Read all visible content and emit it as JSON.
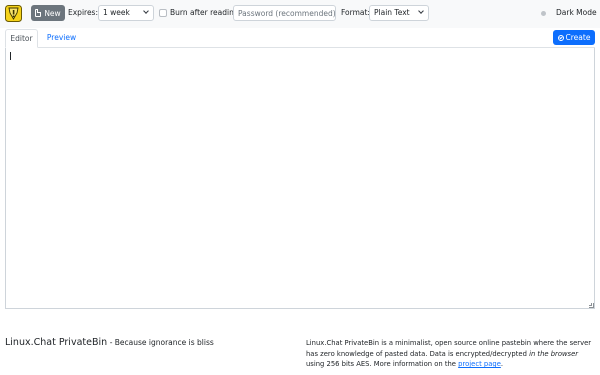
{
  "toolbar": {
    "new_label": "New",
    "expires_label": "Expires:",
    "expires_value": "1 week",
    "burn_label": "Burn after reading",
    "password_placeholder": "Password (recommended)",
    "format_label": "Format:",
    "format_value": "Plain Text",
    "dark_mode_label": "Dark Mode"
  },
  "tabs": [
    {
      "label": "Editor",
      "active": true
    },
    {
      "label": "Preview",
      "active": false
    }
  ],
  "create_label": "Create",
  "editor": {
    "value": ""
  },
  "footer": {
    "brand": "Linux.Chat PrivateBin",
    "tagline": "- Because ignorance is bliss",
    "about_part1": "Linux.Chat PrivateBin is a minimalist, open source online pastebin where the server has zero knowledge of pasted data. Data is encrypted/decrypted ",
    "about_emph": "in the browser",
    "about_part2": " using 256 bits AES. More information on the ",
    "about_link": "project page",
    "about_end": "."
  },
  "colors": {
    "primary": "#0d6efd",
    "secondary": "#6c757d",
    "toolbar_bg": "#f8f9fa"
  },
  "icons": {
    "logo": "privatebin-logo-icon",
    "new": "file-icon",
    "create": "check-circle-icon"
  }
}
